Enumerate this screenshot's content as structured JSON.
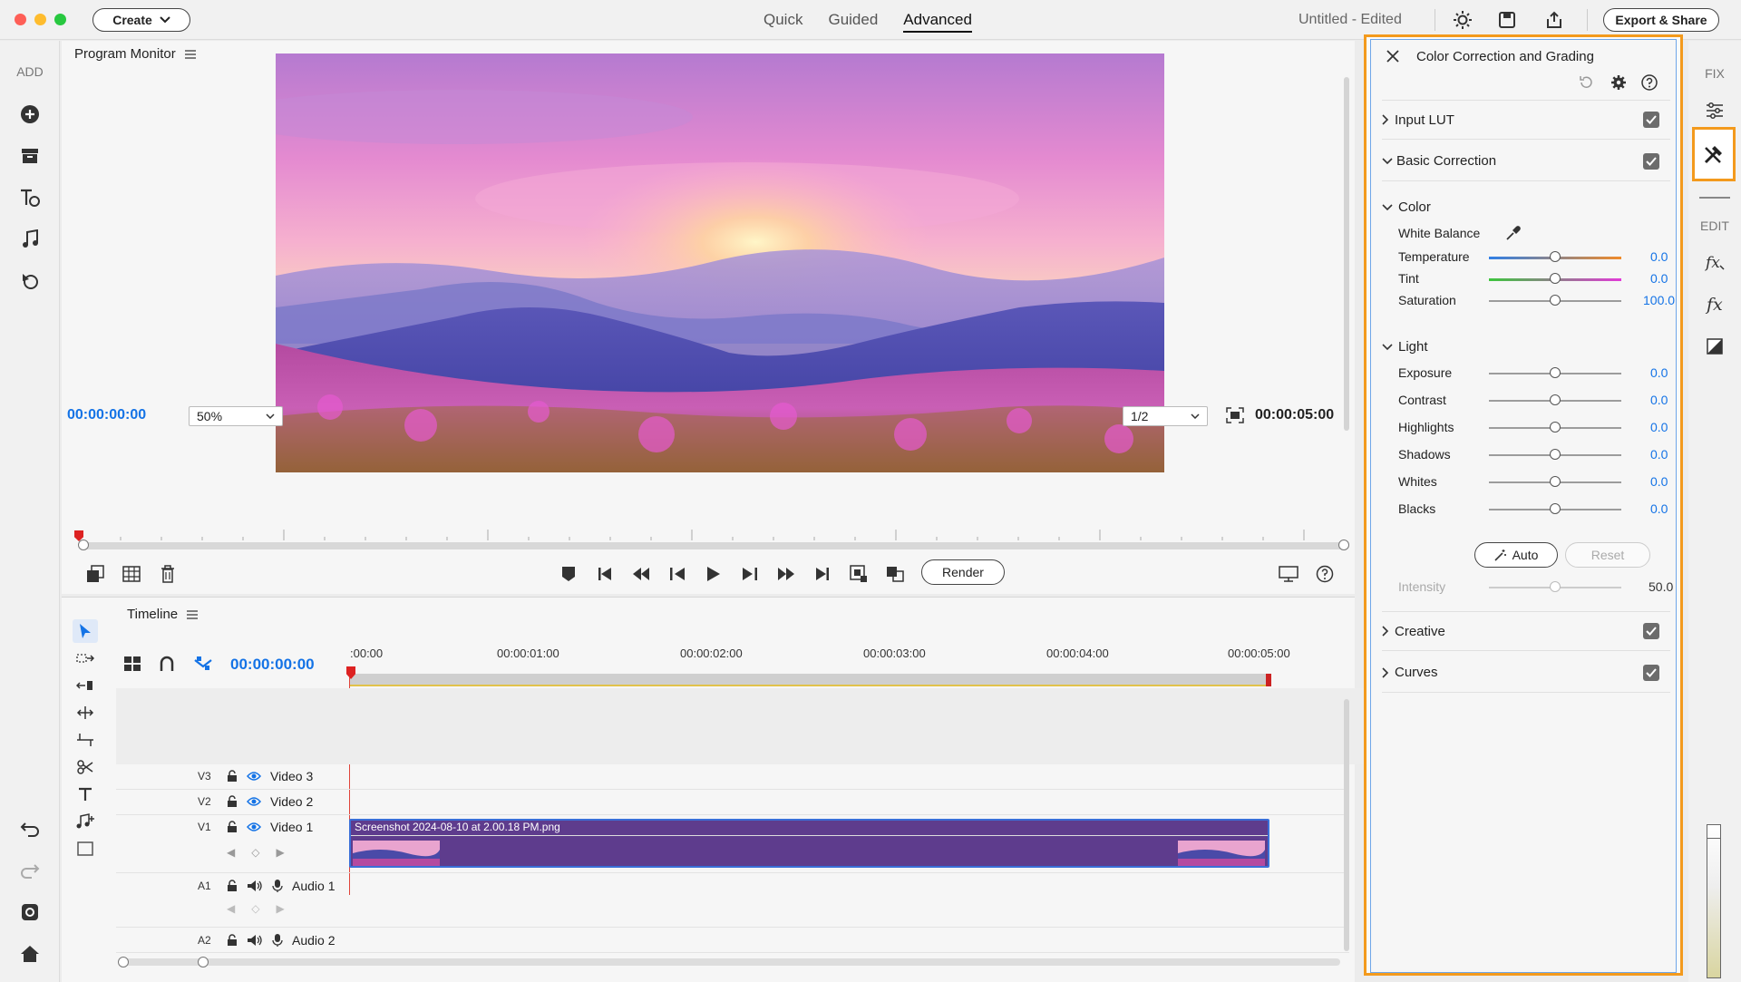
{
  "titlebar": {
    "create_label": "Create",
    "modes": [
      "Quick",
      "Guided",
      "Advanced"
    ],
    "active_mode": "Advanced",
    "document_title": "Untitled - Edited",
    "export_label": "Export & Share"
  },
  "left_bar": {
    "label": "ADD",
    "icons": [
      "add-media-icon",
      "archive-icon",
      "add-title-icon",
      "music-icon",
      "graphics-icon"
    ]
  },
  "monitor": {
    "title": "Program Monitor",
    "current_time": "00:00:00:00",
    "zoom": "50%",
    "resolution": "1/2",
    "duration": "00:00:05:00",
    "render_label": "Render"
  },
  "timeline": {
    "title": "Timeline",
    "current_time": "00:00:00:00",
    "ruler_labels": [
      ":00:00",
      "00:00:01:00",
      "00:00:02:00",
      "00:00:03:00",
      "00:00:04:00",
      "00:00:05:00"
    ],
    "tracks": [
      {
        "id": "V3",
        "name": "Video 3",
        "kind": "video"
      },
      {
        "id": "V2",
        "name": "Video 2",
        "kind": "video"
      },
      {
        "id": "V1",
        "name": "Video 1",
        "kind": "video"
      },
      {
        "id": "A1",
        "name": "Audio 1",
        "kind": "audio"
      },
      {
        "id": "A2",
        "name": "Audio 2",
        "kind": "audio"
      }
    ],
    "clip_name": "Screenshot 2024-08-10 at 2.00.18 PM.png"
  },
  "color_panel": {
    "title": "Color Correction and Grading",
    "sections": {
      "input_lut": "Input LUT",
      "basic_correction": "Basic Correction",
      "creative": "Creative",
      "curves": "Curves"
    },
    "color_group": "Color",
    "white_balance": "White Balance",
    "color_sliders": [
      {
        "label": "Temperature",
        "value": "0.0"
      },
      {
        "label": "Tint",
        "value": "0.0"
      },
      {
        "label": "Saturation",
        "value": "100.0"
      }
    ],
    "light_group": "Light",
    "light_sliders": [
      {
        "label": "Exposure",
        "value": "0.0"
      },
      {
        "label": "Contrast",
        "value": "0.0"
      },
      {
        "label": "Highlights",
        "value": "0.0"
      },
      {
        "label": "Shadows",
        "value": "0.0"
      },
      {
        "label": "Whites",
        "value": "0.0"
      },
      {
        "label": "Blacks",
        "value": "0.0"
      }
    ],
    "auto_label": "Auto",
    "reset_label": "Reset",
    "intensity_label": "Intensity",
    "intensity_value": "50.0"
  },
  "right_bar": {
    "fix_label": "FIX",
    "edit_label": "EDIT"
  },
  "colors": {
    "accent_blue": "#1473e6",
    "highlight_orange": "#f39a1d",
    "clip_purple": "#5e3c8d",
    "playhead_red": "#e0443a"
  }
}
